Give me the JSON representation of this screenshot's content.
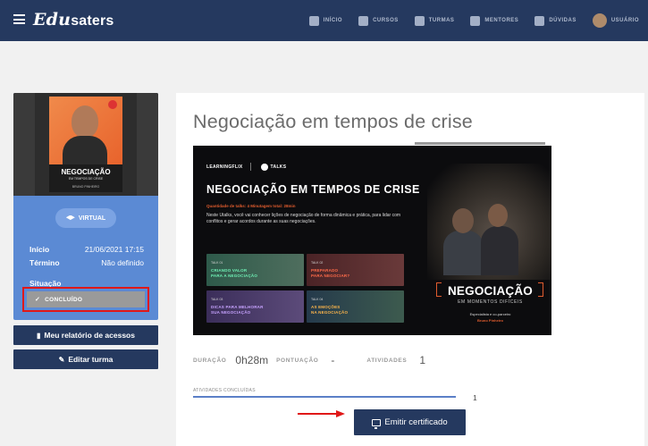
{
  "topbar": {
    "logo_script": "Edu",
    "logo_rest": "saters",
    "nav": [
      "INÍCIO",
      "CURSOS",
      "TURMAS",
      "MENTORES",
      "DÚVIDAS",
      "USUÁRIO"
    ]
  },
  "course": {
    "cover": {
      "title": "NEGOCIAÇÃO",
      "subtitle": "EM TEMPOS DE CRISE",
      "author": "BRUNO PINHEIRO"
    },
    "mode": "VIRTUAL",
    "start_label": "Início",
    "start_value": "21/06/2021 17:15",
    "end_label": "Término",
    "end_value": "Não definido",
    "status_label": "Situação",
    "status_value": "CONCLUÍDO"
  },
  "left_buttons": {
    "report": "Meu relatório de acessos",
    "edit": "Editar turma"
  },
  "main": {
    "title": "Negociação em tempos de crise",
    "banner": {
      "brand": "LEARNINGFLIX",
      "brand_tag": "TALKS",
      "title": "NEGOCIAÇÃO EM TEMPOS DE CRISE",
      "info": "Quantidade de talks: 4   Minutagem total: 28min",
      "description": "Neste Utalks, você vai conhecer lições de negociação de forma dinâmica e prática, para lidar com conflitos e gerar acordos durante as suas negociações.",
      "tiles": [
        {
          "label": "TALK 01",
          "text": "CRIANDO VALOR\nPARA A NEGOCIAÇÃO"
        },
        {
          "label": "TALK 02",
          "text": "PREPARADO\nPARA NEGOCIAR?"
        },
        {
          "label": "TALK 03",
          "text": "DICAS PARA MELHORAR\nSUA NEGOCIAÇÃO"
        },
        {
          "label": "TALK 04",
          "text": "AS EMOÇÕES\nNA NEGOCIAÇÃO"
        }
      ],
      "side_title": "NEGOCIAÇÃO",
      "side_sub": "EM MOMENTOS DIFÍCEIS",
      "side_expert": "Especialista e co-parceiro",
      "side_name": "Bruno Pinheiro"
    },
    "stats": {
      "duration_label": "DURAÇÃO",
      "duration_value": "0h28m",
      "score_label": "PONTUAÇÃO",
      "score_value": "-",
      "activities_label": "ATIVIDADES",
      "activities_value": "1"
    },
    "progress": {
      "label": "ATIVIDADES CONCLUÍDAS",
      "fraction": 1.0,
      "count": "1"
    },
    "certificate_button": "Emitir certificado"
  },
  "colors": {
    "navy": "#25395f",
    "card_blue": "#5b8ad4",
    "highlight_red": "#e01818"
  }
}
